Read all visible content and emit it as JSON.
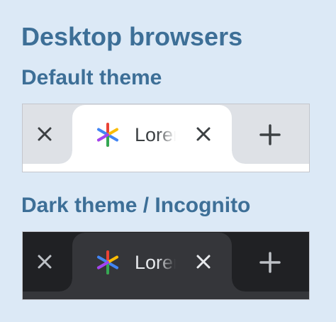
{
  "page": {
    "title": "Desktop browsers"
  },
  "sections": [
    {
      "heading": "Default theme",
      "theme": "light",
      "colors": {
        "strip": "#dee1e6",
        "active_tab": "#ffffff",
        "icon": "#3c4043",
        "text": "#3c4043"
      },
      "tab_title": "Lorem",
      "icons": [
        "close-icon",
        "star-favicon-icon",
        "close-icon",
        "plus-icon"
      ]
    },
    {
      "heading": "Dark theme / Incognito",
      "theme": "dark",
      "colors": {
        "strip": "#202124",
        "active_tab": "#35363a",
        "icon": "#e8eaed",
        "text": "#e8eaed"
      },
      "tab_title": "Lorem",
      "icons": [
        "close-icon",
        "star-favicon-icon",
        "close-icon",
        "plus-icon"
      ]
    }
  ],
  "colors": {
    "background": "#dce9f6",
    "heading": "#3d6f97",
    "favicon": [
      "#4285f4",
      "#ea4335",
      "#fbbc04",
      "#34a853"
    ]
  }
}
